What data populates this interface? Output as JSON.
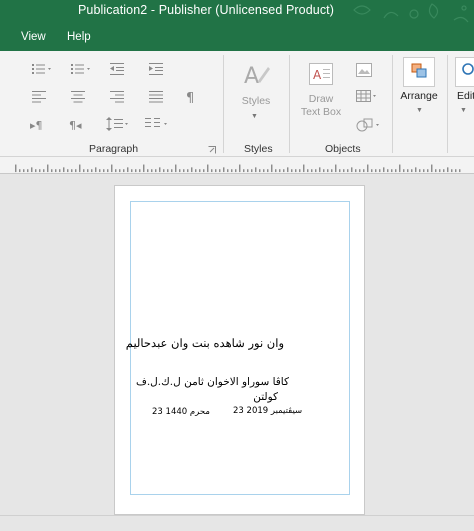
{
  "titlebar": {
    "title": "Publication2  -  Publisher (Unlicensed Product)"
  },
  "menu": {
    "items": [
      "View",
      "Help"
    ]
  },
  "ribbon": {
    "groups": {
      "paragraph": "Paragraph",
      "styles": "Styles",
      "objects": "Objects"
    },
    "styles_button": "Styles",
    "draw_text_box_line1": "Draw",
    "draw_text_box_line2": "Text Box",
    "arrange_button": "Arrange",
    "edit_button": "Editi",
    "colors": {
      "brand": "#217346",
      "ribbon_bg": "#f3f3f3",
      "margin_guide": "#a9d2ec"
    }
  },
  "document": {
    "line1": "وان نور شاهده بنت وان عبدحاليم",
    "line2": "كاڤا سوراو الاخوان ثامن ل.ك.ل.ف",
    "line3": "كولتن",
    "date_gregorian": "23 سيڤتيمبر 2019",
    "date_hijri": "23 محرم 1440"
  }
}
